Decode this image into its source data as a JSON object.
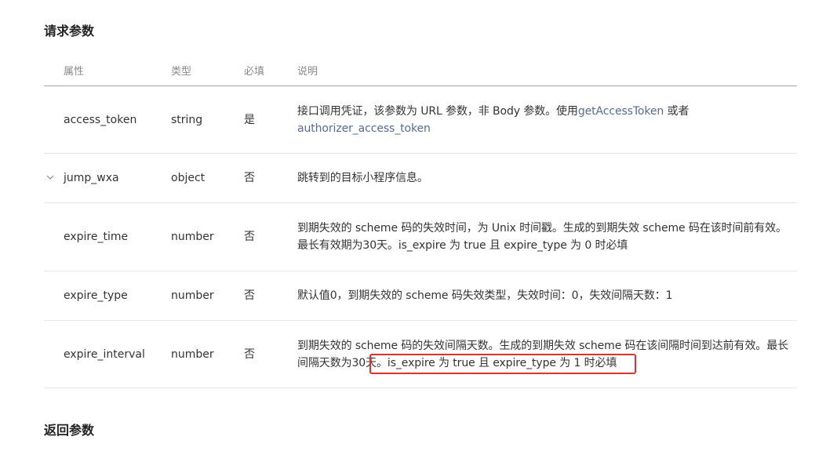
{
  "request_section": {
    "title": "请求参数"
  },
  "response_section": {
    "title": "返回参数"
  },
  "table": {
    "headers": {
      "name": "属性",
      "type": "类型",
      "required": "必填",
      "desc": "说明"
    },
    "rows": [
      {
        "name": "access_token",
        "type": "string",
        "required": "是",
        "desc_prefix": "接口调用凭证，该参数为 URL 参数，非 Body 参数。使用",
        "link1": "getAccessToken",
        "desc_mid": " 或者",
        "link2": "authorizer_access_token"
      },
      {
        "name": "jump_wxa",
        "type": "object",
        "required": "否",
        "desc": "跳转到的目标小程序信息。",
        "expand_icon": "chevron-down-icon"
      },
      {
        "name": "expire_time",
        "type": "number",
        "required": "否",
        "desc": "到期失效的 scheme 码的失效时间，为 Unix 时间戳。生成的到期失效 scheme 码在该时间前有效。最长有效期为30天。is_expire 为 true 且 expire_type 为 0 时必填"
      },
      {
        "name": "expire_type",
        "type": "number",
        "required": "否",
        "desc": "默认值0，到期失效的 scheme 码失效类型，失效时间：0，失效间隔天数：1"
      },
      {
        "name": "expire_interval",
        "type": "number",
        "required": "否",
        "desc": "到期失效的 scheme 码的失效间隔天数。生成的到期失效 scheme 码在该间隔时间到达前有效。最长间隔天数为30天。is_expire 为 true 且 expire_type 为 1 时必填"
      }
    ]
  },
  "annotation": {
    "color": "#e0302c"
  }
}
